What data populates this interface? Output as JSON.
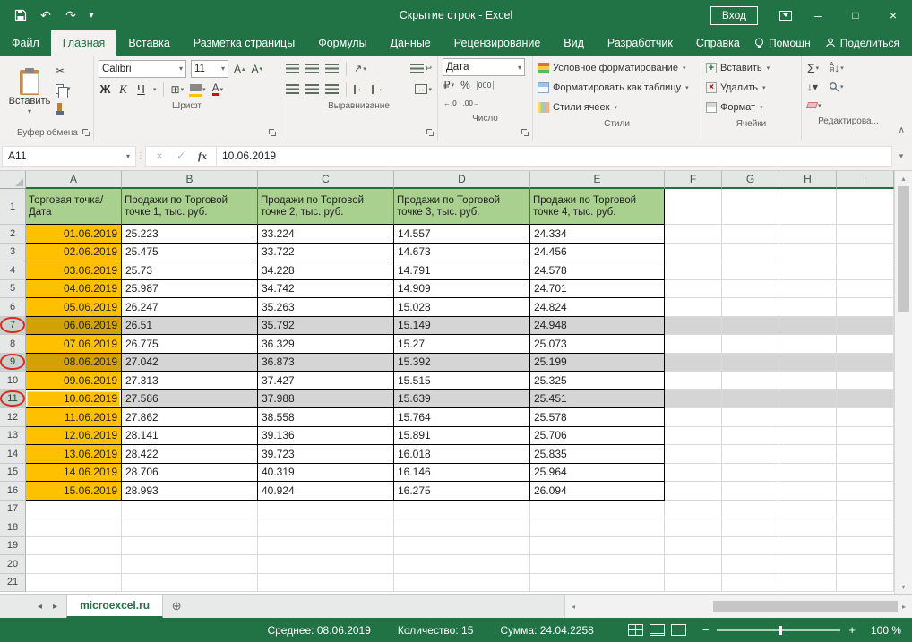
{
  "titlebar": {
    "title": "Скрытие строк - Excel",
    "signin": "Вход"
  },
  "tabs": {
    "items": [
      {
        "label": "Файл"
      },
      {
        "label": "Главная"
      },
      {
        "label": "Вставка"
      },
      {
        "label": "Разметка страницы"
      },
      {
        "label": "Формулы"
      },
      {
        "label": "Данные"
      },
      {
        "label": "Рецензирование"
      },
      {
        "label": "Вид"
      },
      {
        "label": "Разработчик"
      },
      {
        "label": "Справка"
      }
    ],
    "assistant": "Помощн",
    "share": "Поделиться"
  },
  "ribbon": {
    "clipboard": {
      "paste": "Вставить",
      "label": "Буфер обмена"
    },
    "font": {
      "name": "Calibri",
      "size": "11",
      "bold": "Ж",
      "italic": "К",
      "underline": "Ч",
      "label": "Шрифт"
    },
    "alignment": {
      "label": "Выравнивание"
    },
    "number": {
      "format": "Дата",
      "label": "Число"
    },
    "styles": {
      "conditional": "Условное форматирование",
      "format_table": "Форматировать как таблицу",
      "cell_styles": "Стили ячеек",
      "label": "Стили"
    },
    "cells": {
      "insert": "Вставить",
      "delete": "Удалить",
      "format": "Формат",
      "label": "Ячейки"
    },
    "editing": {
      "label": "Редактирова..."
    }
  },
  "formula_bar": {
    "name_box": "A11",
    "fx": "fx",
    "value": "10.06.2019"
  },
  "sheet": {
    "columns": [
      "A",
      "B",
      "C",
      "D",
      "E",
      "F",
      "G",
      "H",
      "I"
    ],
    "header": {
      "n": 1,
      "cells": [
        "Торговая точка/ Дата",
        "Продажи по Торговой точке 1, тыс. руб.",
        "Продажи по Торговой точке 2, тыс. руб.",
        "Продажи по Торговой точке 3, тыс. руб.",
        "Продажи по Торговой точке 4, тыс. руб."
      ]
    },
    "rows": [
      {
        "n": 2,
        "date": "01.06.2019",
        "values": [
          "25.223",
          "33.224",
          "14.557",
          "24.334"
        ]
      },
      {
        "n": 3,
        "date": "02.06.2019",
        "values": [
          "25.475",
          "33.722",
          "14.673",
          "24.456"
        ]
      },
      {
        "n": 4,
        "date": "03.06.2019",
        "values": [
          "25.73",
          "34.228",
          "14.791",
          "24.578"
        ]
      },
      {
        "n": 5,
        "date": "04.06.2019",
        "values": [
          "25.987",
          "34.742",
          "14.909",
          "24.701"
        ]
      },
      {
        "n": 6,
        "date": "05.06.2019",
        "values": [
          "26.247",
          "35.263",
          "15.028",
          "24.824"
        ]
      },
      {
        "n": 7,
        "date": "06.06.2019",
        "values": [
          "26.51",
          "35.792",
          "15.149",
          "24.948"
        ],
        "selected": true,
        "circled": true
      },
      {
        "n": 8,
        "date": "07.06.2019",
        "values": [
          "26.775",
          "36.329",
          "15.27",
          "25.073"
        ]
      },
      {
        "n": 9,
        "date": "08.06.2019",
        "values": [
          "27.042",
          "36.873",
          "15.392",
          "25.199"
        ],
        "selected": true,
        "circled": true
      },
      {
        "n": 10,
        "date": "09.06.2019",
        "values": [
          "27.313",
          "37.427",
          "15.515",
          "25.325"
        ]
      },
      {
        "n": 11,
        "date": "10.06.2019",
        "values": [
          "27.586",
          "37.988",
          "15.639",
          "25.451"
        ],
        "selected": true,
        "circled": true,
        "active": true
      },
      {
        "n": 12,
        "date": "11.06.2019",
        "values": [
          "27.862",
          "38.558",
          "15.764",
          "25.578"
        ]
      },
      {
        "n": 13,
        "date": "12.06.2019",
        "values": [
          "28.141",
          "39.136",
          "15.891",
          "25.706"
        ]
      },
      {
        "n": 14,
        "date": "13.06.2019",
        "values": [
          "28.422",
          "39.723",
          "16.018",
          "25.835"
        ]
      },
      {
        "n": 15,
        "date": "14.06.2019",
        "values": [
          "28.706",
          "40.319",
          "16.146",
          "25.964"
        ]
      },
      {
        "n": 16,
        "date": "15.06.2019",
        "values": [
          "28.993",
          "40.924",
          "16.275",
          "26.094"
        ]
      },
      {
        "n": 17
      },
      {
        "n": 18
      },
      {
        "n": 19
      },
      {
        "n": 20
      },
      {
        "n": 21
      }
    ]
  },
  "sheet_tabs": {
    "active": "microexcel.ru"
  },
  "status_bar": {
    "average": "Среднее: 08.06.2019",
    "count": "Количество: 15",
    "sum": "Сумма: 24.04.2258",
    "zoom": "100 %"
  },
  "colors": {
    "excel_green": "#217346",
    "header_fill": "#A9D08E",
    "date_fill": "#FFC000",
    "selected_date_fill": "#D2A104",
    "selection_gray": "#D5D5D5",
    "annotation_red": "#DC2A24"
  },
  "icons": {
    "dropdown": "▾",
    "undo": "↶",
    "redo": "↷",
    "cut": "✂",
    "borders": "⊞",
    "minimize": "–",
    "maximize": "□",
    "close": "×",
    "cancel": "×",
    "check": "✓",
    "sigma": "Σ",
    "left": "◂",
    "right": "▸",
    "up": "▴",
    "down": "▾",
    "arrow_down": "↓",
    "arrow_left": "←",
    "arrow_right": "→",
    "wrap": "↩",
    "merge": "↔",
    "orientation": "↗",
    "new_sheet": "⊕",
    "font_letter": "А",
    "sort_a": "А",
    "sort_z": "Я",
    "percent": "%",
    "thousands": "000",
    "currency": "₽",
    "inc_decimal": "←.0",
    "dec_decimal": ".00→",
    "minus": "−",
    "plus": "+",
    "collapse": "∧",
    "up_scroll": "▴",
    "down_scroll": "▾"
  }
}
